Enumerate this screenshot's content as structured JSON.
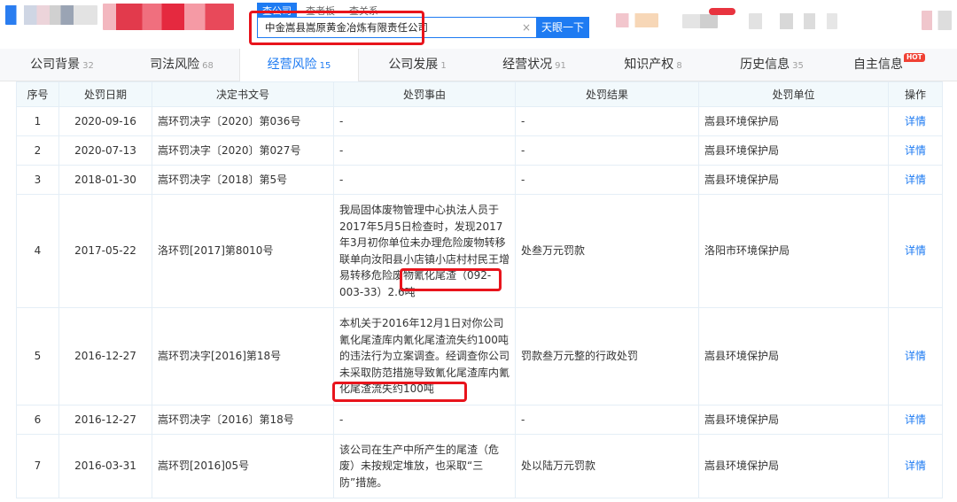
{
  "header": {
    "search_tabs": [
      "查公司",
      "查老板",
      "查关系"
    ],
    "search_value": "中金嵩县嵩原黄金冶炼有限责任公司",
    "clear_symbol": "×",
    "search_button": "天眼一下"
  },
  "tabs": [
    {
      "label": "公司背景",
      "count": "32"
    },
    {
      "label": "司法风险",
      "count": "68"
    },
    {
      "label": "经营风险",
      "count": "15"
    },
    {
      "label": "公司发展",
      "count": "1"
    },
    {
      "label": "经营状况",
      "count": "91"
    },
    {
      "label": "知识产权",
      "count": "8"
    },
    {
      "label": "历史信息",
      "count": "35"
    },
    {
      "label": "自主信息",
      "count": ""
    }
  ],
  "hot_badge": "HOT",
  "table": {
    "headers": [
      "序号",
      "处罚日期",
      "决定书文号",
      "处罚事由",
      "处罚结果",
      "处罚单位",
      "操作"
    ],
    "rows": [
      {
        "no": "1",
        "date": "2020-09-16",
        "doc": "嵩环罚决字〔2020〕第036号",
        "reason": "-",
        "result": "-",
        "unit": "嵩县环境保护局",
        "action": "详情"
      },
      {
        "no": "2",
        "date": "2020-07-13",
        "doc": "嵩环罚决字〔2020〕第027号",
        "reason": "-",
        "result": "-",
        "unit": "嵩县环境保护局",
        "action": "详情"
      },
      {
        "no": "3",
        "date": "2018-01-30",
        "doc": "嵩环罚决字〔2018〕第5号",
        "reason": "-",
        "result": "-",
        "unit": "嵩县环境保护局",
        "action": "详情"
      },
      {
        "no": "4",
        "date": "2017-05-22",
        "doc": "洛环罚[2017]第8010号",
        "reason": "我局固体废物管理中心执法人员于2017年5月5日检查时，发现2017年3月初你单位未办理危险废物转移联单向汝阳县小店镇小店村村民王增易转移危险废物氰化尾渣（092-003-33）2.6吨",
        "result": "处叁万元罚款",
        "unit": "洛阳市环境保护局",
        "action": "详情"
      },
      {
        "no": "5",
        "date": "2016-12-27",
        "doc": "嵩环罚决字[2016]第18号",
        "reason": "本机关于2016年12月1日对你公司氰化尾渣库内氰化尾渣流失约100吨的违法行为立案调查。经调查你公司未采取防范措施导致氰化尾渣库内氰化尾渣流失约100吨",
        "result": "罚款叁万元整的行政处罚",
        "unit": "嵩县环境保护局",
        "action": "详情"
      },
      {
        "no": "6",
        "date": "2016-12-27",
        "doc": "嵩环罚决字〔2016〕第18号",
        "reason": "-",
        "result": "-",
        "unit": "嵩县环境保护局",
        "action": "详情"
      },
      {
        "no": "7",
        "date": "2016-03-31",
        "doc": "嵩环罚[2016]05号",
        "reason": "该公司在生产中所产生的尾渣（危废）未按规定堆放，也采取“三防”措施。",
        "result": "处以陆万元罚款",
        "unit": "嵩县环境保护局",
        "action": "详情"
      }
    ]
  },
  "colors": {
    "accent": "#1E7BF2",
    "annotation_red": "#e8141c",
    "header_bg": "#f2f9fc"
  }
}
